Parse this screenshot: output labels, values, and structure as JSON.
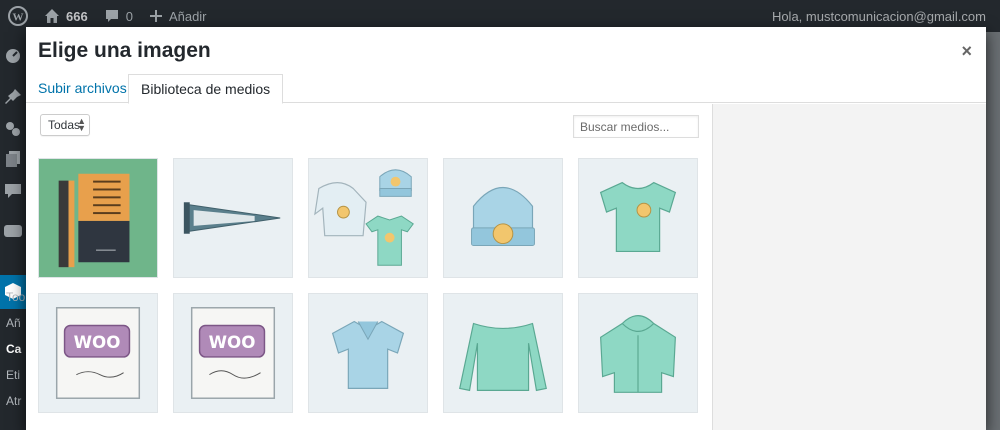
{
  "adminbar": {
    "site_count": "666",
    "comment_count": "0",
    "new_label": "Añadir",
    "greeting": "Hola, mustcomunicacion@gmail.com"
  },
  "sidebar": {
    "labels": [
      "Too",
      "Añ",
      "Ca",
      "Eti",
      "Atr"
    ]
  },
  "modal": {
    "title": "Elige una imagen",
    "close_symbol": "×",
    "tabs": [
      {
        "label": "Subir archivos",
        "active": false
      },
      {
        "label": "Biblioteca de medios",
        "active": true
      }
    ],
    "filter": {
      "selected": "Todas"
    },
    "search": {
      "placeholder": "Buscar medios..."
    },
    "items": [
      {
        "name": "book",
        "icon": "book-cover"
      },
      {
        "name": "pennant",
        "icon": "pennant"
      },
      {
        "name": "clothing-set",
        "icon": "clothing-set"
      },
      {
        "name": "beanie",
        "icon": "beanie"
      },
      {
        "name": "v-neck-tshirt",
        "icon": "tshirt"
      },
      {
        "name": "woo-single",
        "icon": "woo-album"
      },
      {
        "name": "woo-album",
        "icon": "woo-album"
      },
      {
        "name": "polo",
        "icon": "polo-shirt"
      },
      {
        "name": "long-sleeve",
        "icon": "long-sleeve-shirt"
      },
      {
        "name": "hoodie",
        "icon": "hoodie"
      }
    ]
  },
  "colors": {
    "admin_bg": "#23282d",
    "accent": "#0073aa",
    "thumb_bg": "#eaf0f3",
    "mint": "#8ed8c4",
    "woo_purple": "#9b5c8f",
    "book_bg": "#6fb58a"
  }
}
